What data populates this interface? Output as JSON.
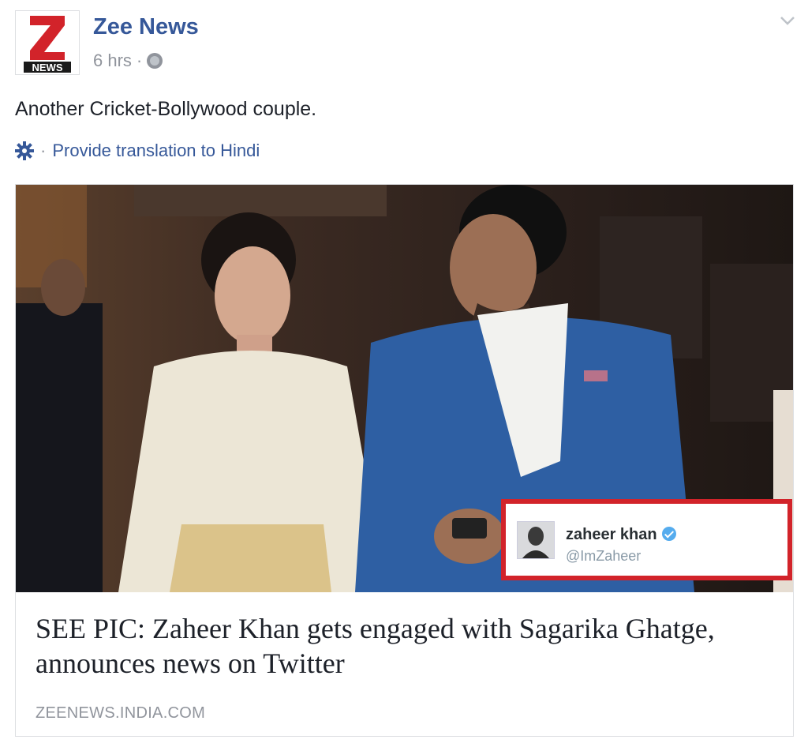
{
  "header": {
    "page_name": "Zee News",
    "time": "6 hrs",
    "separator": "·",
    "logo_letter": "Z",
    "logo_text": "NEWS"
  },
  "post": {
    "text": "Another Cricket-Bollywood couple.",
    "translation_link": "Provide translation to Hindi",
    "translation_sep": "·"
  },
  "link_card": {
    "headline": "SEE PIC: Zaheer Khan gets engaged with Sagarika Ghatge, announces news on Twitter",
    "domain": "ZEENEWS.INDIA.COM",
    "tweet": {
      "name": "zaheer khan",
      "handle": "@ImZaheer"
    }
  },
  "icons": [
    "gear-icon",
    "globe-icon",
    "chevron-down-icon",
    "verified-icon"
  ],
  "colors": {
    "link": "#365899",
    "meta": "#90949c",
    "tweet_border": "#d2232a",
    "logo_red": "#d2232a"
  }
}
